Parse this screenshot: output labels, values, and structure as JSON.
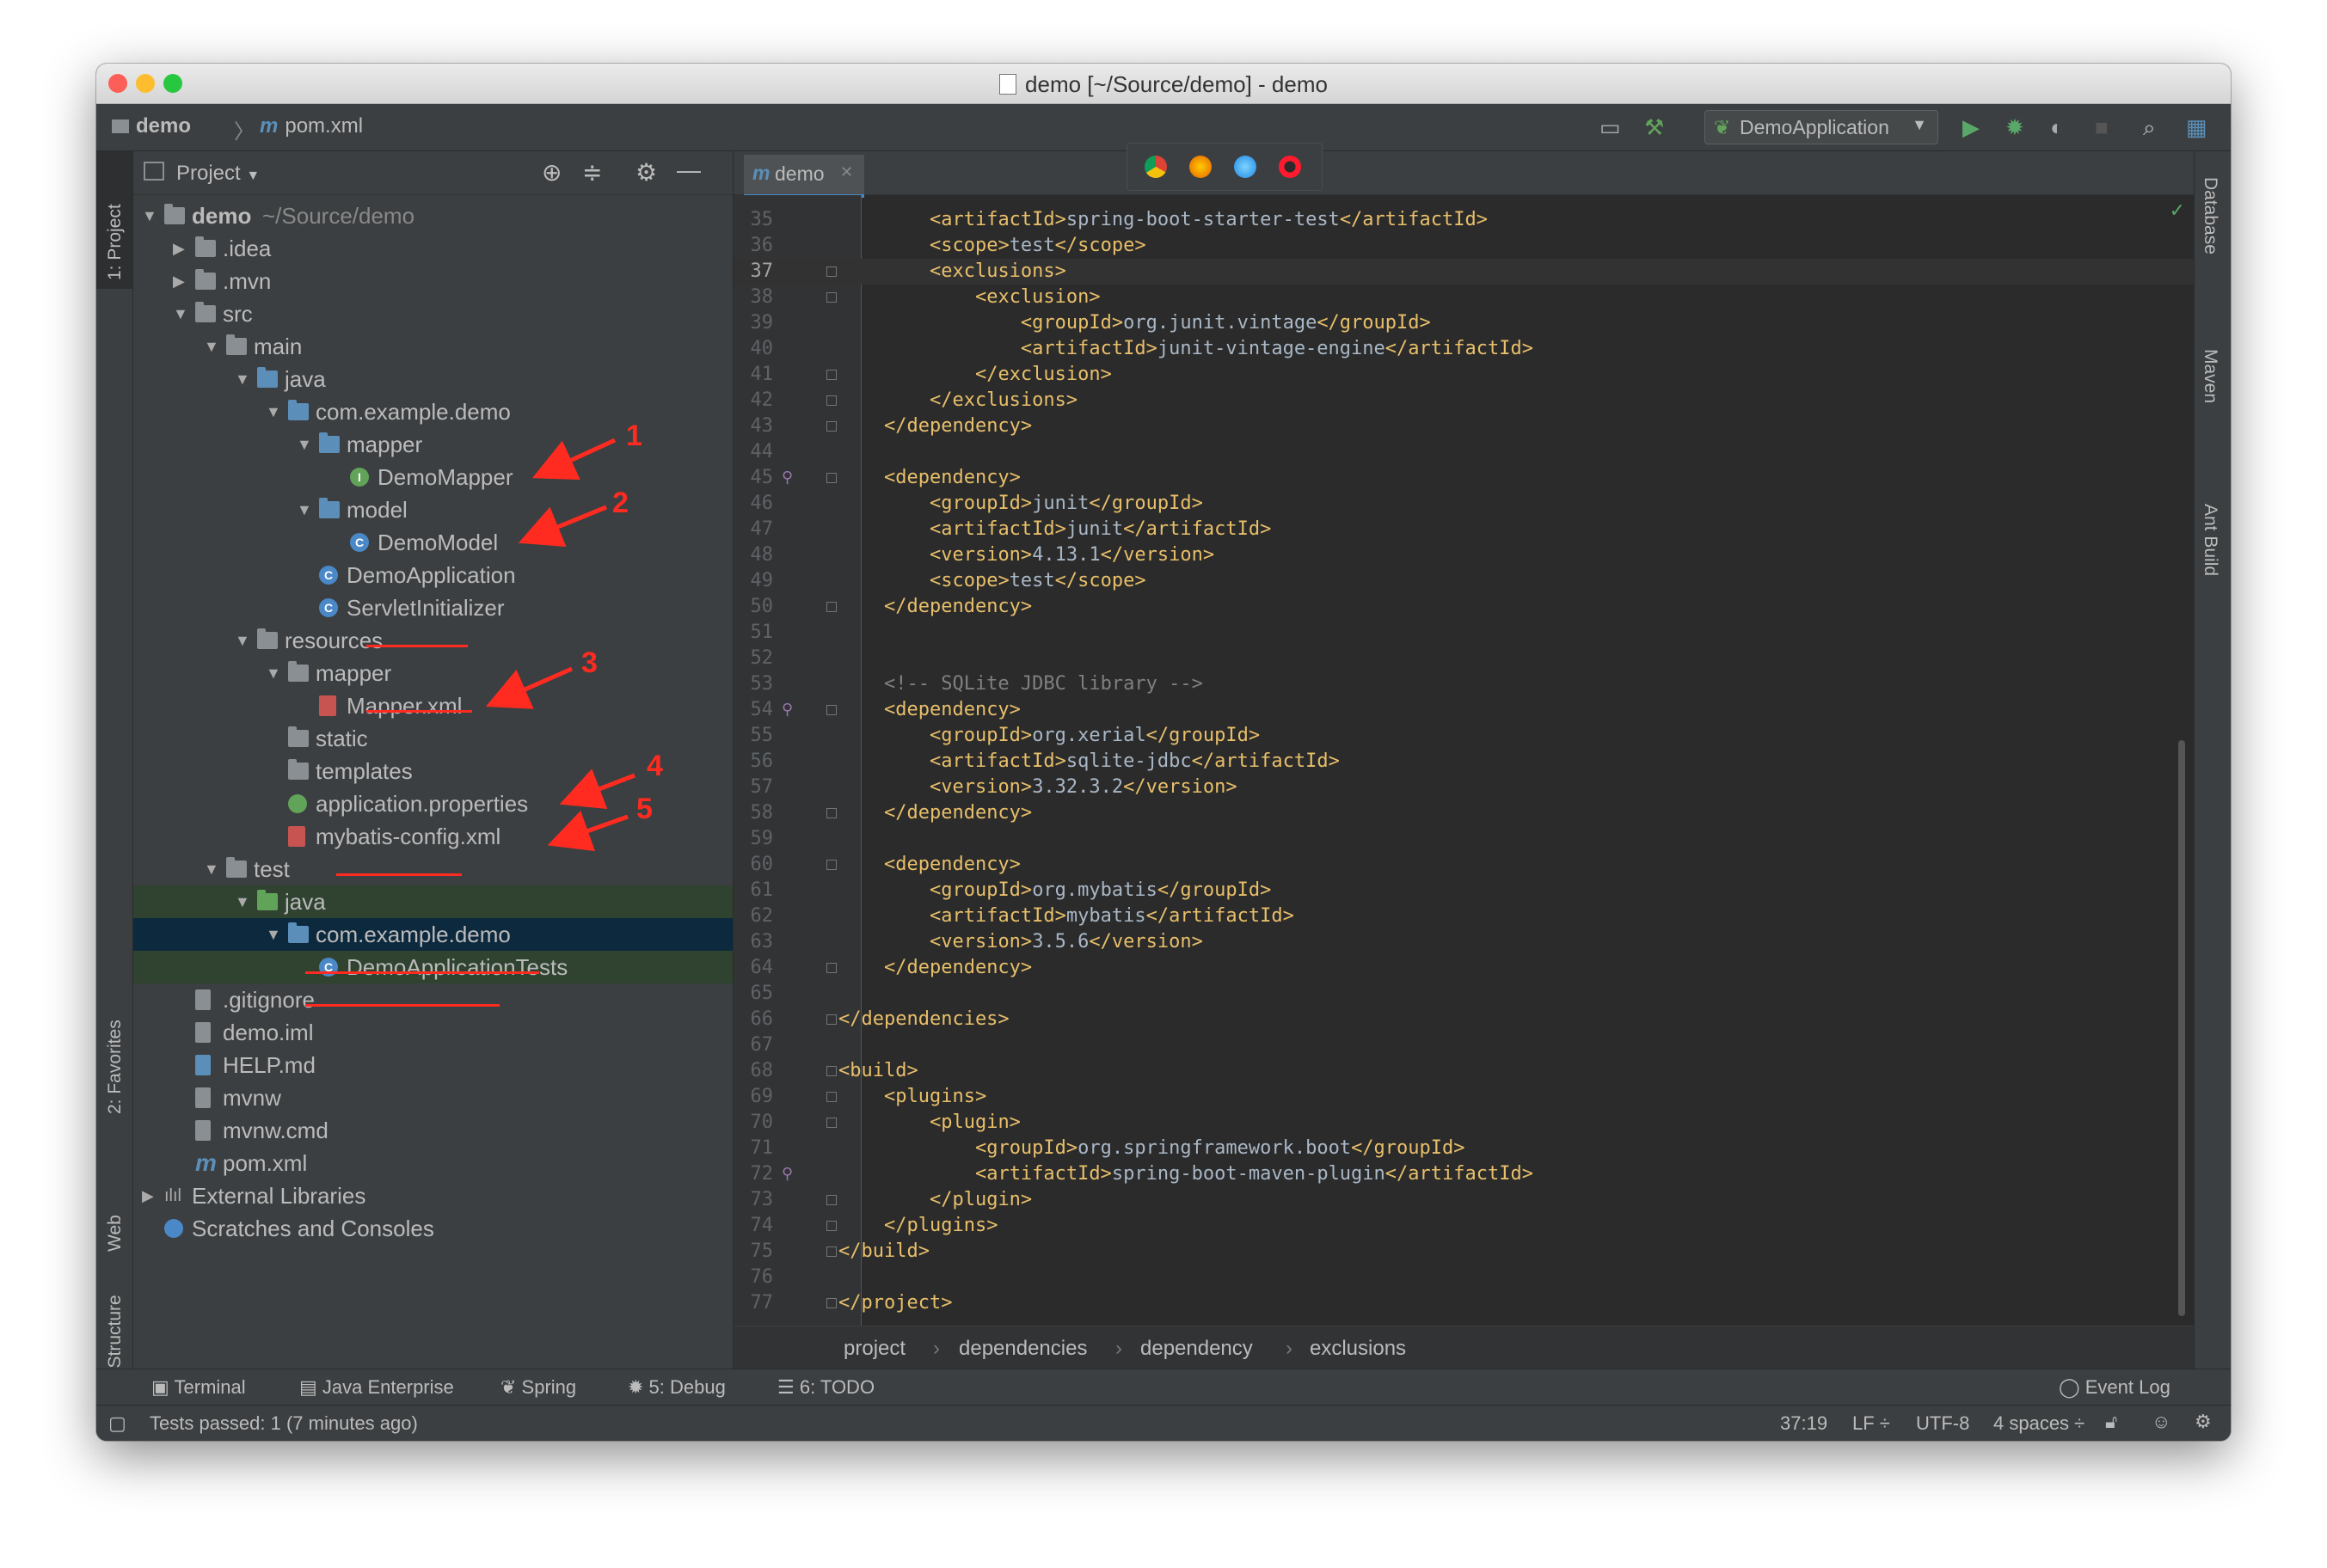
{
  "window": {
    "title": "demo [~/Source/demo] - demo"
  },
  "navbar": {
    "project": "demo",
    "file": "pom.xml",
    "run_config": "DemoApplication"
  },
  "left_strip": {
    "project": "1: Project",
    "favorites": "2: Favorites",
    "web": "Web",
    "structure": "Z: Structure"
  },
  "right_strip": {
    "database": "Database",
    "maven": "Maven",
    "ant": "Ant Build"
  },
  "project_panel": {
    "title": "Project",
    "tree": [
      {
        "label": "demo",
        "extra": "~/Source/demo",
        "icon": "folder-icon",
        "arrow": "▼",
        "level": 0
      },
      {
        "label": ".idea",
        "icon": "folder-icon",
        "arrow": "▶",
        "level": 1
      },
      {
        "label": ".mvn",
        "icon": "folder-icon",
        "arrow": "▶",
        "level": 1
      },
      {
        "label": "src",
        "icon": "folder-icon",
        "arrow": "▼",
        "level": 1
      },
      {
        "label": "main",
        "icon": "folder-icon",
        "arrow": "▼",
        "level": 2
      },
      {
        "label": "java",
        "icon": "source-folder-icon",
        "arrow": "▼",
        "level": 3
      },
      {
        "label": "com.example.demo",
        "icon": "package-icon",
        "arrow": "▼",
        "level": 4
      },
      {
        "label": "mapper",
        "icon": "package-icon",
        "arrow": "▼",
        "level": 5
      },
      {
        "label": "DemoMapper",
        "icon": "interface-icon",
        "arrow": "",
        "level": 6
      },
      {
        "label": "model",
        "icon": "package-icon",
        "arrow": "▼",
        "level": 5
      },
      {
        "label": "DemoModel",
        "icon": "class-icon",
        "arrow": "",
        "level": 6
      },
      {
        "label": "DemoApplication",
        "icon": "spring-class-icon",
        "arrow": "",
        "level": 5
      },
      {
        "label": "ServletInitializer",
        "icon": "class-icon",
        "arrow": "",
        "level": 5
      },
      {
        "label": "resources",
        "icon": "resources-folder-icon",
        "arrow": "▼",
        "level": 3
      },
      {
        "label": "mapper",
        "icon": "folder-icon",
        "arrow": "▼",
        "level": 4
      },
      {
        "label": "Mapper.xml",
        "icon": "xml-file-icon",
        "arrow": "",
        "level": 5
      },
      {
        "label": "static",
        "icon": "folder-icon",
        "arrow": "",
        "level": 4
      },
      {
        "label": "templates",
        "icon": "folder-icon",
        "arrow": "",
        "level": 4
      },
      {
        "label": "application.properties",
        "icon": "spring-properties-icon",
        "arrow": "",
        "level": 4
      },
      {
        "label": "mybatis-config.xml",
        "icon": "xml-file-icon",
        "arrow": "",
        "level": 4
      },
      {
        "label": "test",
        "icon": "folder-icon",
        "arrow": "▼",
        "level": 2
      },
      {
        "label": "java",
        "icon": "test-folder-icon",
        "arrow": "▼",
        "level": 3
      },
      {
        "label": "com.example.demo",
        "icon": "package-icon",
        "arrow": "▼",
        "level": 4
      },
      {
        "label": "DemoApplicationTests",
        "icon": "class-icon",
        "arrow": "",
        "level": 5
      },
      {
        "label": ".gitignore",
        "icon": "file-icon",
        "arrow": "",
        "level": 1
      },
      {
        "label": "demo.iml",
        "icon": "file-icon",
        "arrow": "",
        "level": 1
      },
      {
        "label": "HELP.md",
        "icon": "md-file-icon",
        "arrow": "",
        "level": 1
      },
      {
        "label": "mvnw",
        "icon": "file-icon",
        "arrow": "",
        "level": 1
      },
      {
        "label": "mvnw.cmd",
        "icon": "file-icon",
        "arrow": "",
        "level": 1
      },
      {
        "label": "pom.xml",
        "icon": "maven-icon",
        "arrow": "",
        "level": 1
      },
      {
        "label": "External Libraries",
        "icon": "libraries-icon",
        "arrow": "▶",
        "level": 0
      },
      {
        "label": "Scratches and Consoles",
        "icon": "scratches-icon",
        "arrow": "",
        "level": 0
      }
    ],
    "annotations": [
      "1",
      "2",
      "3",
      "4",
      "5"
    ]
  },
  "editor": {
    "tab": "demo",
    "lines": [
      {
        "n": "35",
        "text": "        <artifactId>spring-boot-starter-test</artifactId>"
      },
      {
        "n": "36",
        "text": "        <scope>test</scope>"
      },
      {
        "n": "37",
        "text": "        <exclusions>"
      },
      {
        "n": "38",
        "text": "            <exclusion>"
      },
      {
        "n": "39",
        "text": "                <groupId>org.junit.vintage</groupId>"
      },
      {
        "n": "40",
        "text": "                <artifactId>junit-vintage-engine</artifactId>"
      },
      {
        "n": "41",
        "text": "            </exclusion>"
      },
      {
        "n": "42",
        "text": "        </exclusions>"
      },
      {
        "n": "43",
        "text": "    </dependency>"
      },
      {
        "n": "44",
        "text": ""
      },
      {
        "n": "45",
        "text": "    <dependency>"
      },
      {
        "n": "46",
        "text": "        <groupId>junit</groupId>"
      },
      {
        "n": "47",
        "text": "        <artifactId>junit</artifactId>"
      },
      {
        "n": "48",
        "text": "        <version>4.13.1</version>"
      },
      {
        "n": "49",
        "text": "        <scope>test</scope>"
      },
      {
        "n": "50",
        "text": "    </dependency>"
      },
      {
        "n": "51",
        "text": ""
      },
      {
        "n": "52",
        "text": ""
      },
      {
        "n": "53",
        "text": "    <!-- SQLite JDBC library -->"
      },
      {
        "n": "54",
        "text": "    <dependency>"
      },
      {
        "n": "55",
        "text": "        <groupId>org.xerial</groupId>"
      },
      {
        "n": "56",
        "text": "        <artifactId>sqlite-jdbc</artifactId>"
      },
      {
        "n": "57",
        "text": "        <version>3.32.3.2</version>"
      },
      {
        "n": "58",
        "text": "    </dependency>"
      },
      {
        "n": "59",
        "text": ""
      },
      {
        "n": "60",
        "text": "    <dependency>"
      },
      {
        "n": "61",
        "text": "        <groupId>org.mybatis</groupId>"
      },
      {
        "n": "62",
        "text": "        <artifactId>mybatis</artifactId>"
      },
      {
        "n": "63",
        "text": "        <version>3.5.6</version>"
      },
      {
        "n": "64",
        "text": "    </dependency>"
      },
      {
        "n": "65",
        "text": ""
      },
      {
        "n": "66",
        "text": "</dependencies>"
      },
      {
        "n": "67",
        "text": ""
      },
      {
        "n": "68",
        "text": "<build>"
      },
      {
        "n": "69",
        "text": "    <plugins>"
      },
      {
        "n": "70",
        "text": "        <plugin>"
      },
      {
        "n": "71",
        "text": "            <groupId>org.springframework.boot</groupId>"
      },
      {
        "n": "72",
        "text": "            <artifactId>spring-boot-maven-plugin</artifactId>"
      },
      {
        "n": "73",
        "text": "        </plugin>"
      },
      {
        "n": "74",
        "text": "    </plugins>"
      },
      {
        "n": "75",
        "text": "</build>"
      },
      {
        "n": "76",
        "text": ""
      },
      {
        "n": "77",
        "text": "</project>"
      }
    ],
    "breadcrumb": [
      "project",
      "dependencies",
      "dependency",
      "exclusions"
    ]
  },
  "tool_windows": {
    "terminal": "Terminal",
    "java_enterprise": "Java Enterprise",
    "spring": "Spring",
    "debug": "5: Debug",
    "todo": "6: TODO",
    "event_log": "Event Log"
  },
  "status": {
    "message": "Tests passed: 1 (7 minutes ago)",
    "position": "37:19",
    "line_sep": "LF ÷",
    "encoding": "UTF-8",
    "indent": "4 spaces ÷"
  },
  "colors": {
    "annotation": "#ff2b20",
    "tag": "#e8bf6a",
    "comment": "#808080",
    "text": "#a9b7c6"
  }
}
